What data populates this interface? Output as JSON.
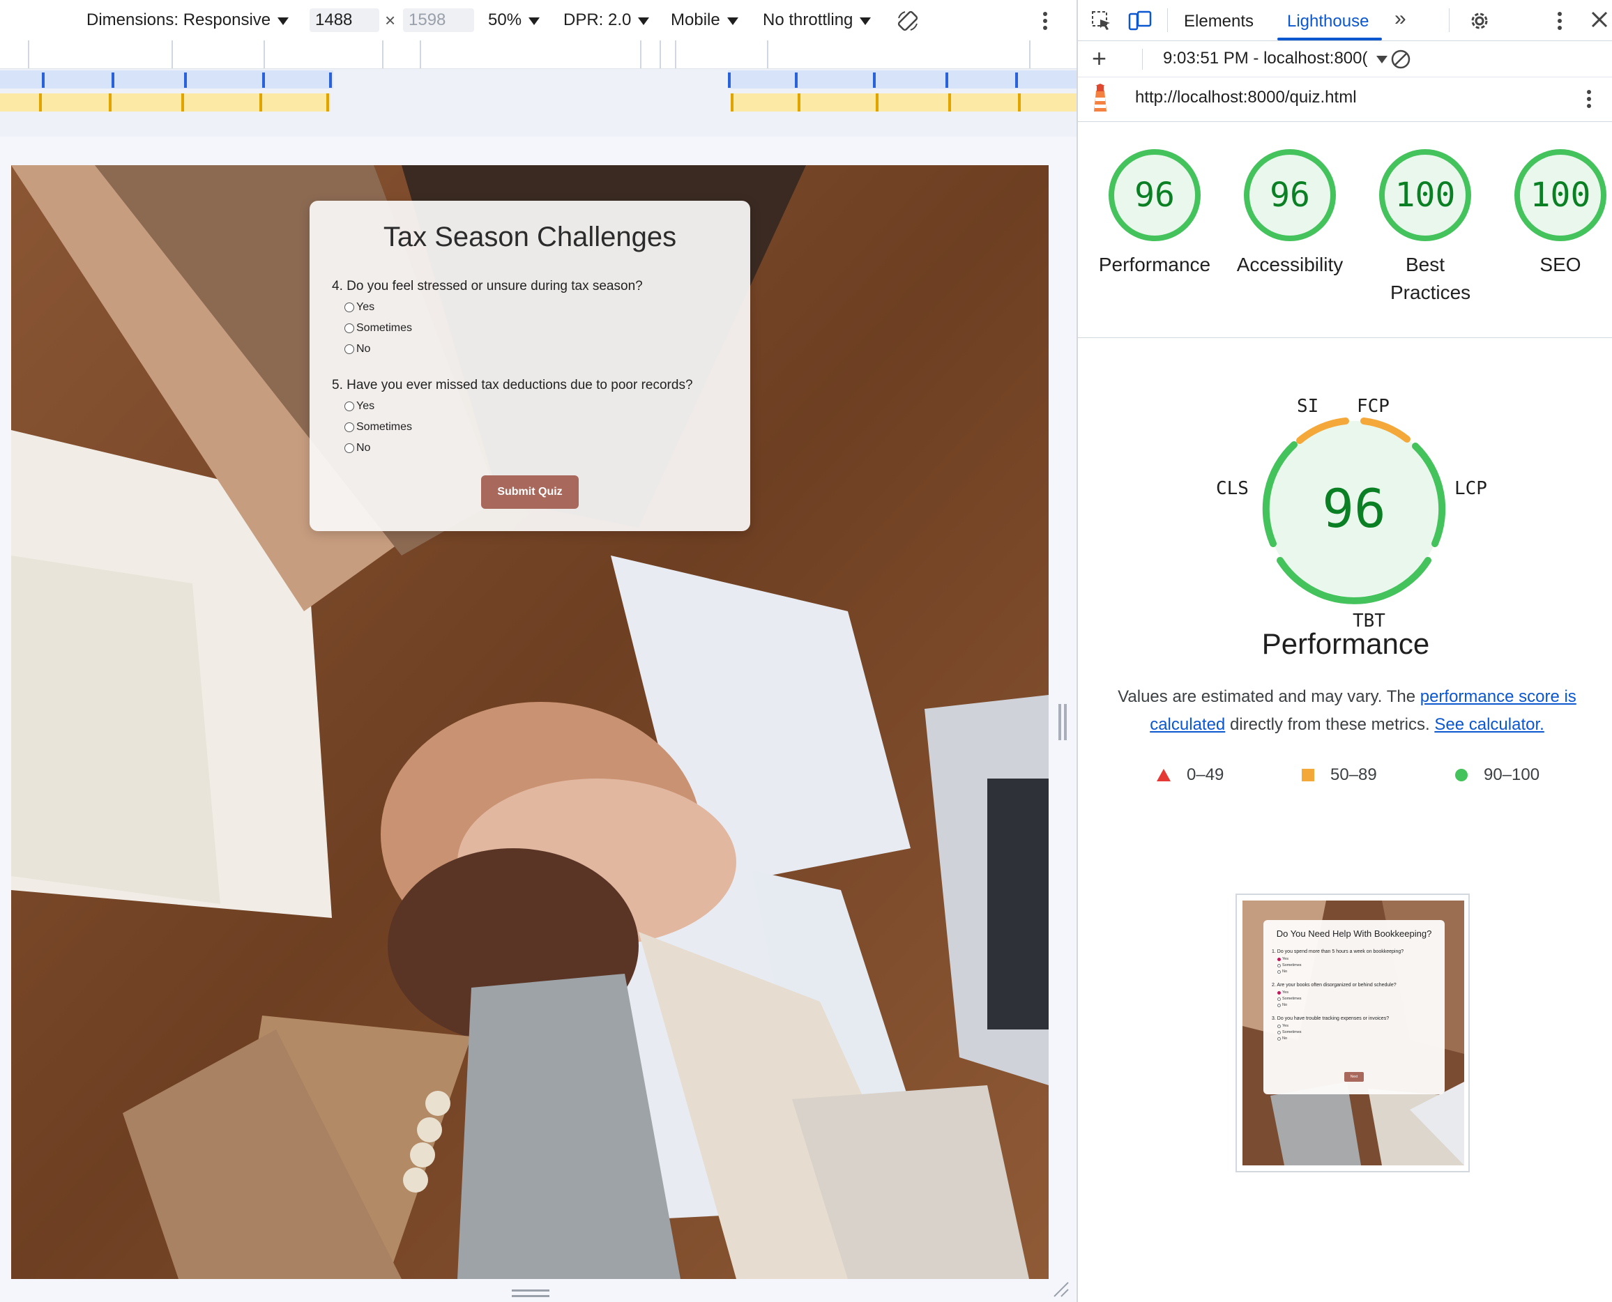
{
  "device_toolbar": {
    "dimensions_label": "Dimensions: Responsive",
    "width": "1488",
    "height": "1598",
    "zoom": "50%",
    "dpr": "DPR: 2.0",
    "device_type": "Mobile",
    "throttling": "No throttling"
  },
  "quiz": {
    "title": "Tax Season Challenges",
    "questions": [
      {
        "text": "4. Do you feel stressed or unsure during tax season?",
        "options": [
          "Yes",
          "Sometimes",
          "No"
        ]
      },
      {
        "text": "5. Have you ever missed tax deductions due to poor records?",
        "options": [
          "Yes",
          "Sometimes",
          "No"
        ]
      }
    ],
    "submit_label": "Submit Quiz"
  },
  "devtools": {
    "tabs": {
      "elements": "Elements",
      "lighthouse": "Lighthouse"
    },
    "report_selector": "9:03:51 PM - localhost:800(",
    "url": "http://localhost:8000/quiz.html",
    "scores": [
      {
        "value": "96",
        "label": "Performance"
      },
      {
        "value": "96",
        "label": "Accessibility"
      },
      {
        "value": "100",
        "label": "Best Practices"
      },
      {
        "value": "100",
        "label": "SEO"
      }
    ],
    "performance": {
      "score": "96",
      "title": "Performance",
      "metrics": {
        "si": "SI",
        "fcp": "FCP",
        "cls": "CLS",
        "lcp": "LCP",
        "tbt": "TBT"
      },
      "desc_prefix": "Values are estimated and may vary. The ",
      "desc_link1": "performance score is calculated",
      "desc_middle": " directly from these metrics. ",
      "desc_link2": "See calculator."
    },
    "legend": [
      {
        "range": "0–49",
        "color": "#e53935",
        "shape": "triangle"
      },
      {
        "range": "50–89",
        "color": "#f4a83a",
        "shape": "square"
      },
      {
        "range": "90–100",
        "color": "#44c25c",
        "shape": "circle"
      }
    ],
    "thumbnail": {
      "title": "Do You Need Help With Bookkeeping?",
      "questions": [
        {
          "text": "1. Do you spend more than 5 hours a week on bookkeeping?",
          "options": [
            "Yes",
            "Sometimes",
            "No"
          ]
        },
        {
          "text": "2. Are your books often disorganized or behind schedule?",
          "options": [
            "Yes",
            "Sometimes",
            "No"
          ]
        },
        {
          "text": "3. Do you have trouble tracking expenses or invoices?",
          "options": [
            "Yes",
            "Sometimes",
            "No"
          ]
        }
      ],
      "next_label": "Next"
    }
  },
  "colors": {
    "accent_blue": "#0b57d0",
    "score_green": "#0a7f23",
    "gauge_green": "#44c25c",
    "gauge_orange": "#f4a83a",
    "button_brown": "#a8685b"
  }
}
